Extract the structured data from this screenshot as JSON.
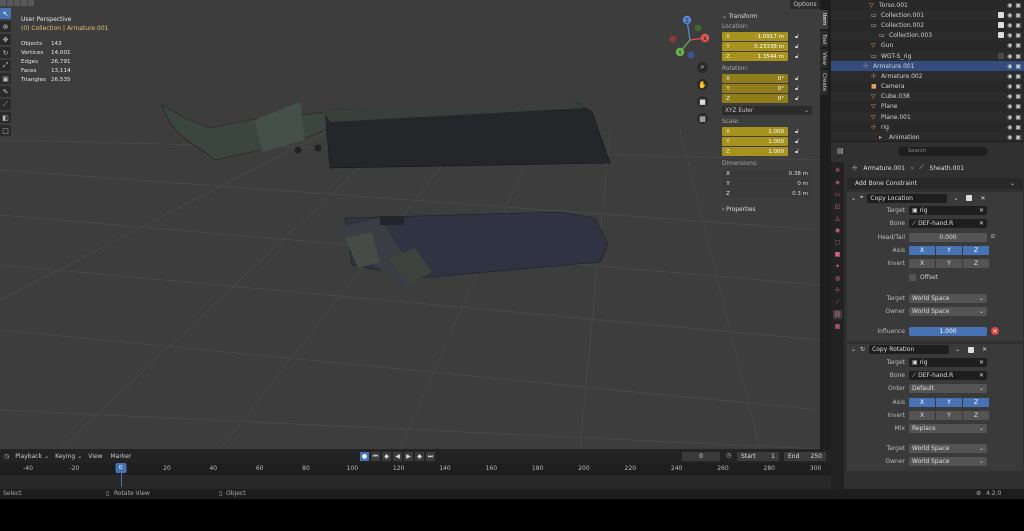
{
  "viewport": {
    "perspective": "User Perspective",
    "collection": "(0) Collection | Armature.001",
    "options_label": "Options",
    "stats": [
      {
        "k": "Objects",
        "v": "143"
      },
      {
        "k": "Vertices",
        "v": "14,001"
      },
      {
        "k": "Edges",
        "v": "26,791"
      },
      {
        "k": "Faces",
        "v": "13,114"
      },
      {
        "k": "Triangles",
        "v": "26,535"
      }
    ],
    "gizmo": {
      "x": "X",
      "y": "Y",
      "z": "Z"
    }
  },
  "npanel": {
    "transform_title": "Transform",
    "location_label": "Location:",
    "location": [
      {
        "axis": "X",
        "value": "-1.0917 m"
      },
      {
        "axis": "Y",
        "value": "0.23338 m"
      },
      {
        "axis": "Z",
        "value": "1.3544 m"
      }
    ],
    "rotation_label": "Rotation:",
    "rotation": [
      {
        "axis": "X",
        "value": "0°"
      },
      {
        "axis": "Y",
        "value": "0°"
      },
      {
        "axis": "Z",
        "value": "0°"
      }
    ],
    "rotation_mode": "XYZ Euler",
    "scale_label": "Scale:",
    "scale": [
      {
        "axis": "X",
        "value": "1.000"
      },
      {
        "axis": "Y",
        "value": "1.000"
      },
      {
        "axis": "Z",
        "value": "1.000"
      }
    ],
    "dimensions_label": "Dimensions:",
    "dimensions": [
      {
        "axis": "X",
        "value": "0.38 m"
      },
      {
        "axis": "Y",
        "value": "0 m"
      },
      {
        "axis": "Z",
        "value": "0.3 m"
      }
    ],
    "properties_label": "Properties",
    "tabs": [
      "Item",
      "Tool",
      "View",
      "Create"
    ]
  },
  "outliner": {
    "rows": [
      {
        "name": "Torso.001",
        "indent": 38,
        "icon": "▽"
      },
      {
        "name": "Collection.001",
        "indent": 40,
        "icon": "▭"
      },
      {
        "name": "Collection.002",
        "indent": 40,
        "icon": "▭"
      },
      {
        "name": "Collection.003",
        "indent": 48,
        "icon": "▭"
      },
      {
        "name": "Gun",
        "indent": 40,
        "icon": "▽"
      },
      {
        "name": "WGT-S_rig",
        "indent": 40,
        "icon": "▭"
      },
      {
        "name": "Armature.001",
        "indent": 32,
        "icon": "☩"
      },
      {
        "name": "Armature.002",
        "indent": 40,
        "icon": "☩"
      },
      {
        "name": "Camera",
        "indent": 40,
        "icon": "■"
      },
      {
        "name": "Cube.038",
        "indent": 40,
        "icon": "▽"
      },
      {
        "name": "Plane",
        "indent": 40,
        "icon": "▽"
      },
      {
        "name": "Plane.001",
        "indent": 40,
        "icon": "▽"
      },
      {
        "name": "rig",
        "indent": 40,
        "icon": "☩"
      },
      {
        "name": "Animation",
        "indent": 48,
        "icon": "▸"
      }
    ]
  },
  "props": {
    "search_placeholder": "Search",
    "breadcrumb_obj": "Armature.001",
    "breadcrumb_bone": "Sheath.001",
    "add_constraint": "Add Bone Constraint",
    "copy_location": {
      "name": "Copy Location",
      "target_label": "Target",
      "target": "rig",
      "bone_label": "Bone",
      "bone": "DEF-hand.R",
      "headtail_label": "Head/Tail",
      "headtail": "0.000",
      "axis_label": "Axis",
      "invert_label": "Invert",
      "offset_label": "Offset",
      "target_space_label": "Target",
      "target_space": "World Space",
      "owner_space_label": "Owner",
      "owner_space": "World Space",
      "influence_label": "Influence",
      "influence": "1.000"
    },
    "copy_rotation": {
      "name": "Copy Rotation",
      "target_label": "Target",
      "target": "rig",
      "bone_label": "Bone",
      "bone": "DEF-hand.R",
      "order_label": "Order",
      "order": "Default",
      "axis_label": "Axis",
      "invert_label": "Invert",
      "mix_label": "Mix",
      "mix": "Replace",
      "target_space_label": "Target",
      "target_space": "World Space",
      "owner_space_label": "Owner",
      "owner_space": "World Space"
    },
    "axes": [
      "X",
      "Y",
      "Z"
    ]
  },
  "timeline": {
    "menus": [
      "Playback",
      "Keying",
      "View",
      "Marker"
    ],
    "current_frame": "0",
    "start_label": "Start",
    "start": "1",
    "end_label": "End",
    "end": "250",
    "ticks": [
      "-40",
      "-20",
      "0",
      "20",
      "40",
      "60",
      "80",
      "100",
      "120",
      "140",
      "160",
      "180",
      "200",
      "220",
      "240",
      "260",
      "280",
      "300"
    ],
    "playhead": "0"
  },
  "status": {
    "select": "Select",
    "rotate": "Rotate View",
    "object": "Object",
    "version": "4.2.0"
  }
}
